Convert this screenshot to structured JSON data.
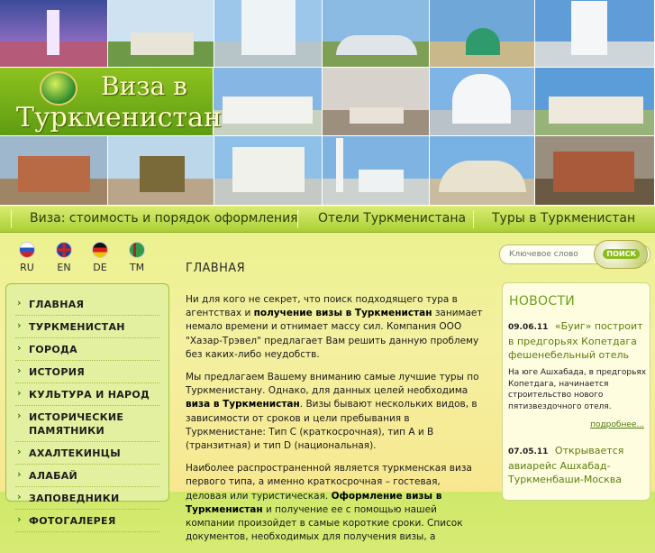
{
  "logo": {
    "line1": "Виза в",
    "line2": "Туркменистан"
  },
  "nav": {
    "items": [
      "Виза: стоимость и порядок оформления",
      "Отели Туркменистана",
      "Туры в Туркменистан"
    ]
  },
  "languages": [
    {
      "code": "RU",
      "icon": "russia-flag-icon"
    },
    {
      "code": "EN",
      "icon": "uk-flag-icon"
    },
    {
      "code": "DE",
      "icon": "germany-flag-icon"
    },
    {
      "code": "TM",
      "icon": "turkmenistan-flag-icon"
    }
  ],
  "menu": {
    "items": [
      "ГЛАВНАЯ",
      "ТУРКМЕНИСТАН",
      "ГОРОДА",
      "ИСТОРИЯ",
      "КУЛЬТУРА И НАРОД",
      "ИСТОРИЧЕСКИЕ ПАМЯТНИКИ",
      "АХАЛТЕКИНЦЫ",
      "АЛАБАЙ",
      "ЗАПОВЕДНИКИ",
      "ФОТОГАЛЕРЕЯ"
    ]
  },
  "main": {
    "heading": "ГЛАВНАЯ",
    "p1_a": "Ни для кого не секрет, что поиск подходящего тура в агентствах и ",
    "p1_b": "получение визы в Туркменистан",
    "p1_c": " занимает немало времени и отнимает массу сил. Компания ООО \"Хазар-Трэвел\" предлагает Вам решить данную проблему без каких-либо неудобств.",
    "p2_a": "Мы предлагаем Вашему вниманию самые лучшие туры по Туркменистану. Однако, для данных целей необходима ",
    "p2_b": "виза в Туркменистан",
    "p2_c": ". Визы бывают нескольких видов, в зависимости от сроков и цели пребывания в Туркменистане: Тип С (краткосрочная), тип А и В (транзитная) и тип D (национальная).",
    "p3_a": "Наиболее распространенной является туркменская виза первого типа, а именно краткосрочная – гостевая, деловая или туристическая. ",
    "p3_b": "Оформление визы в Туркменистан",
    "p3_c": " и получение ее с помощью нашей компании произойдет в самые короткие сроки. Список документов, необходимых для получения визы, а"
  },
  "search": {
    "placeholder": "Ключевое слово",
    "button": "ПОИСК"
  },
  "news": {
    "title": "НОВОСТИ",
    "item1_date": "09.06.11",
    "item1_headline": "«Буиг» построит в предгорьях Копетдага фешенебельный отель",
    "item1_summary": "На юге Ашхабада, в предгорьях Копетдага, начинается строительство нового пятизвездочного отеля.",
    "more": "подробнее...",
    "item2_date": "07.05.11",
    "item2_headline": "Открывается авиарейс Ашхабад-Туркменбаши-Москва"
  }
}
